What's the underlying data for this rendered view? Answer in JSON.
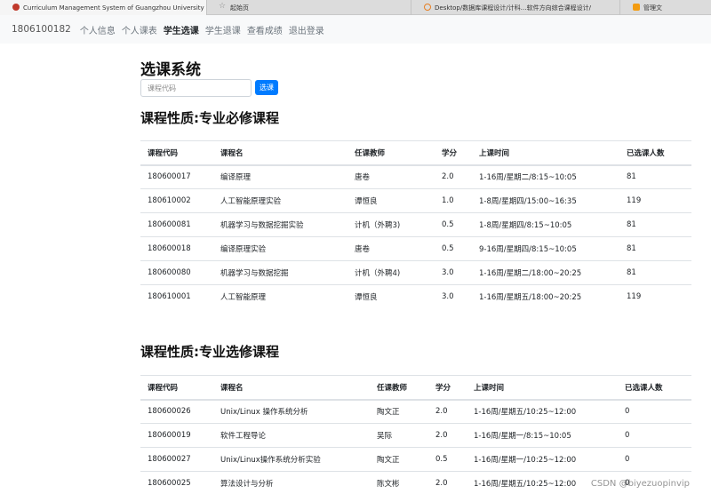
{
  "browser": {
    "tabs": [
      {
        "label": "Curriculum Management System of Guangzhou University",
        "active": true,
        "icon": "university-logo-icon"
      },
      {
        "label": "起始页",
        "active": false,
        "icon": "star-icon"
      },
      {
        "label": "Desktop/数据库课程设计/计科…软件方向综合课程设计/",
        "active": false,
        "icon": "loading-ring-icon"
      },
      {
        "label": "管理文",
        "active": false,
        "icon": "page-icon"
      }
    ]
  },
  "nav": {
    "student_id": "1806100182",
    "items": [
      {
        "label": "个人信息",
        "active": false
      },
      {
        "label": "个人课表",
        "active": false
      },
      {
        "label": "学生选课",
        "active": true
      },
      {
        "label": "学生退课",
        "active": false
      },
      {
        "label": "查看成绩",
        "active": false
      },
      {
        "label": "退出登录",
        "active": false
      }
    ]
  },
  "main": {
    "title": "选课系统",
    "search": {
      "placeholder": "课程代码",
      "value": ""
    },
    "search_button": "选课"
  },
  "sections": [
    {
      "title": "课程性质:专业必修课程",
      "columns": [
        "课程代码",
        "课程名",
        "任课教师",
        "学分",
        "上课时间",
        "已选课人数"
      ],
      "rows": [
        [
          "180600017",
          "编译原理",
          "唐卷",
          "2.0",
          "1-16周/星期二/8:15~10:05",
          "81"
        ],
        [
          "180610002",
          "人工智能原理实验",
          "谭恒良",
          "1.0",
          "1-8周/星期四/15:00~16:35",
          "119"
        ],
        [
          "180600081",
          "机器学习与数据挖掘实验",
          "计机（外聘3)",
          "0.5",
          "1-8周/星期四/8:15~10:05",
          "81"
        ],
        [
          "180600018",
          "编译原理实验",
          "唐卷",
          "0.5",
          "9-16周/星期四/8:15~10:05",
          "81"
        ],
        [
          "180600080",
          "机器学习与数据挖掘",
          "计机（外聘4)",
          "3.0",
          "1-16周/星期二/18:00~20:25",
          "81"
        ],
        [
          "180610001",
          "人工智能原理",
          "谭恒良",
          "3.0",
          "1-16周/星期五/18:00~20:25",
          "119"
        ]
      ]
    },
    {
      "title": "课程性质:专业选修课程",
      "columns": [
        "课程代码",
        "课程名",
        "任课教师",
        "学分",
        "上课时间",
        "已选课人数"
      ],
      "rows": [
        [
          "180600026",
          "Unix/Linux 操作系统分析",
          "陶文正",
          "2.0",
          "1-16周/星期五/10:25~12:00",
          "0"
        ],
        [
          "180600019",
          "软件工程导论",
          "吴际",
          "2.0",
          "1-16周/星期一/8:15~10:05",
          "0"
        ],
        [
          "180600027",
          "Unix/Linux操作系统分析实验",
          "陶文正",
          "0.5",
          "1-16周/星期一/10:25~12:00",
          "0"
        ],
        [
          "180600025",
          "算法设计与分析",
          "陈文彬",
          "2.0",
          "1-16周/星期五/10:25~12:00",
          "0"
        ]
      ]
    }
  ],
  "watermark": "CSDN @biyezuopinvip"
}
